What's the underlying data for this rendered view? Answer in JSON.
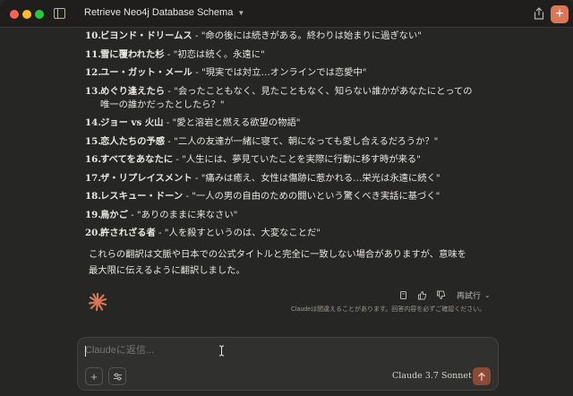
{
  "window": {
    "title": "Retrieve Neo4j Database Schema"
  },
  "list": [
    {
      "num": "10.",
      "name": "ビヨンド・ドリームス",
      "desc": " - \"命の後には続きがある。終わりは始まりに過ぎない\""
    },
    {
      "num": "11.",
      "name": "雪に覆われた杉",
      "desc": " - \"初恋は続く。永遠に\""
    },
    {
      "num": "12.",
      "name": "ユー・ガット・メール",
      "desc": " - \"現実では対立…オンラインでは恋愛中\""
    },
    {
      "num": "13.",
      "name": "めぐり逢えたら",
      "desc": " - \"会ったこともなく、見たこともなく、知らない誰かがあなたにとっての唯一の誰かだったとしたら？\""
    },
    {
      "num": "14.",
      "name": "ジョー vs 火山",
      "desc": " - \"愛と溶岩と燃える欲望の物語\""
    },
    {
      "num": "15.",
      "name": "恋人たちの予感",
      "desc": " - \"二人の友達が一緒に寝て、朝になっても愛し合えるだろうか？\""
    },
    {
      "num": "16.",
      "name": "すべてをあなたに",
      "desc": " - \"人生には、夢見ていたことを実際に行動に移す時が来る\""
    },
    {
      "num": "17.",
      "name": "ザ・リプレイスメント",
      "desc": " - \"痛みは癒え、女性は傷跡に惹かれる…栄光は永遠に続く\""
    },
    {
      "num": "18.",
      "name": "レスキュー・ドーン",
      "desc": " - \"一人の男の自由のための闘いという驚くべき実話に基づく\""
    },
    {
      "num": "19.",
      "name": "鳥かご",
      "desc": " - \"ありのままに来なさい\""
    },
    {
      "num": "20.",
      "name": "許されざる者",
      "desc": " - \"人を殺すというのは、大変なことだ\""
    }
  ],
  "paragraph": "これらの翻訳は文脈や日本での公式タイトルと完全に一致しない場合がありますが、意味を最大限に伝えるように翻訳しました。",
  "actions": {
    "retry_label": "再試行"
  },
  "disclaimer": "Claudeは間違えることがあります。回答内容を必ずご確認ください。",
  "composer": {
    "placeholder": "Claudeに返信...",
    "model_label": "Claude 3.7 Sonnet"
  },
  "colors": {
    "accent": "#d97757",
    "background": "#262624"
  }
}
